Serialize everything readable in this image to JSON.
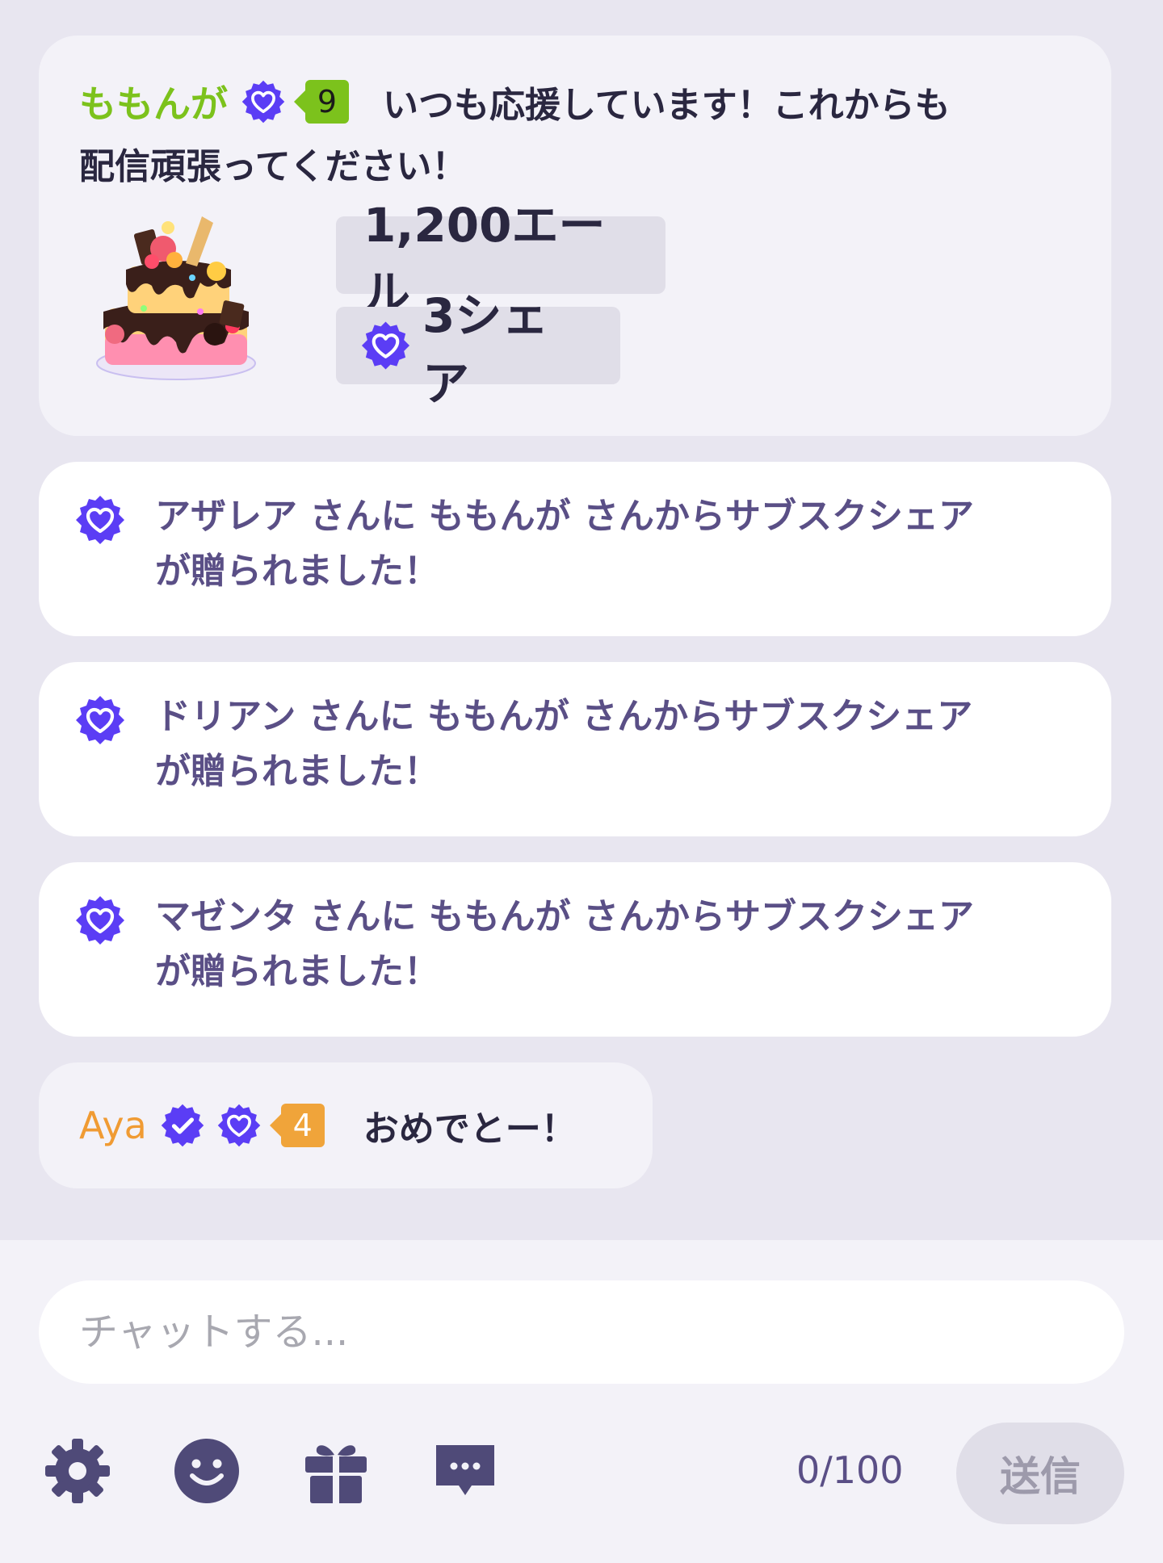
{
  "colors": {
    "background": "#e8e6f0",
    "bubble": "#f3f2f8",
    "notice_bubble": "#ffffff",
    "badge_purple": "#5b3df5",
    "username_green": "#7cc21c",
    "username_orange": "#f09b33",
    "icon_dark": "#4f4a78"
  },
  "gift_message": {
    "username": "ももんが",
    "level": "9",
    "message_line1": "いつも応援しています！これからも",
    "message_line2": "配信頑張ってください！",
    "gift_icon": "cake-image",
    "yell_amount": "1,200エール",
    "share_count": "3シェア"
  },
  "notices": [
    {
      "line1": "アザレア さんに ももんが さんからサブスクシェア",
      "line2": "が贈られました！"
    },
    {
      "line1": "ドリアン さんに ももんが さんからサブスクシェア",
      "line2": "が贈られました！"
    },
    {
      "line1": "マゼンタ さんに ももんが さんからサブスクシェア",
      "line2": "が贈られました！"
    }
  ],
  "chat_message": {
    "username": "Aya",
    "level": "4",
    "message": "おめでとー！"
  },
  "input_bar": {
    "placeholder": "チャットする...",
    "char_counter": "0/100",
    "send_label": "送信",
    "tools": [
      "gear-icon",
      "smiley-icon",
      "gift-icon",
      "chat-menu-icon"
    ]
  }
}
